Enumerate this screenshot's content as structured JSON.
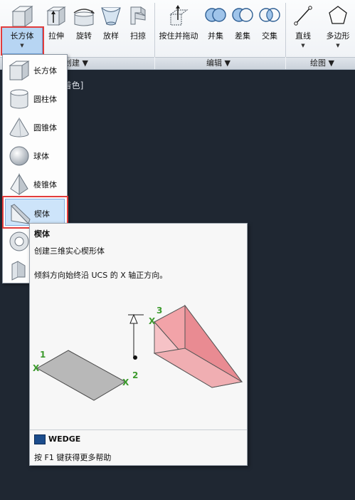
{
  "ribbon": {
    "create_tools": [
      {
        "name": "box",
        "label": "长方体"
      },
      {
        "name": "extrude",
        "label": "拉伸"
      },
      {
        "name": "revolve",
        "label": "旋转"
      },
      {
        "name": "loft",
        "label": "放样"
      },
      {
        "name": "sweep",
        "label": "扫掠"
      }
    ],
    "edit_tools": [
      {
        "name": "presspull",
        "label": "按住并拖动"
      },
      {
        "name": "union",
        "label": "并集"
      },
      {
        "name": "subtract",
        "label": "差集"
      },
      {
        "name": "intersect",
        "label": "交集"
      }
    ],
    "draw_tools": [
      {
        "name": "line",
        "label": "直线"
      },
      {
        "name": "polygon",
        "label": "多边形"
      }
    ],
    "panels": {
      "create": "创建 ▼",
      "edit": "编辑 ▼",
      "draw": "绘图 ▼"
    },
    "dropdown_arrow": "▼"
  },
  "viewport_label": "]着色]",
  "menu_items": [
    {
      "label": "长方体",
      "icon": "box-icon"
    },
    {
      "label": "圆柱体",
      "icon": "cylinder-icon"
    },
    {
      "label": "圆锥体",
      "icon": "cone-icon"
    },
    {
      "label": "球体",
      "icon": "sphere-icon"
    },
    {
      "label": "棱锥体",
      "icon": "pyramid-icon"
    },
    {
      "label": "楔体",
      "icon": "wedge-icon"
    }
  ],
  "tooltip": {
    "title": "楔体",
    "description": "创建三维实心楔形体",
    "detail": "倾斜方向始终沿 UCS 的 X 轴正方向。",
    "point_labels": [
      "1",
      "2",
      "3"
    ],
    "x_mark": "X",
    "command": "WEDGE",
    "help": "按 F1 键获得更多帮助"
  }
}
